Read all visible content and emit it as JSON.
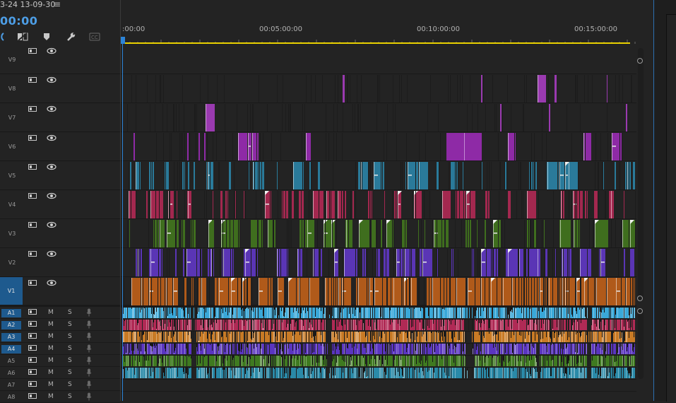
{
  "sequence": {
    "title": "3-24 13-09-30",
    "timecode": "00:00"
  },
  "icons": {
    "menu": "hamburger-menu-icon",
    "snap": "snap-icon",
    "linked": "linked-selection-icon",
    "marker": "marker-icon",
    "settings": "wrench-icon",
    "captions": "captions-icon",
    "toggle_output": "film-icon",
    "visibility": "eye-icon",
    "voiceover": "microphone-icon"
  },
  "ruler": {
    "labels": [
      ":00:00",
      "00:05:00:00",
      "00:10:00:00",
      "00:15:00:00"
    ]
  },
  "video_tracks": [
    {
      "id": "V9"
    },
    {
      "id": "V8"
    },
    {
      "id": "V7"
    },
    {
      "id": "V6"
    },
    {
      "id": "V5"
    },
    {
      "id": "V4"
    },
    {
      "id": "V3"
    },
    {
      "id": "V2"
    },
    {
      "id": "V1",
      "selected": true
    }
  ],
  "audio_tracks": [
    {
      "id": "A1",
      "selected": true
    },
    {
      "id": "A2",
      "selected": true
    },
    {
      "id": "A3",
      "selected": true
    },
    {
      "id": "A4",
      "selected": true
    },
    {
      "id": "A5"
    },
    {
      "id": "A6"
    },
    {
      "id": "A7"
    },
    {
      "id": "A8"
    }
  ],
  "audio_buttons": {
    "mute": "M",
    "solo": "S"
  },
  "colors": {
    "V8": "#9a3ab0",
    "V7": "#9a3ab0",
    "V6": "#8e2aa6",
    "V5": "#2a7a9a",
    "V4": "#a3284f",
    "V3": "#3f6e1e",
    "V2": "#5a35b5",
    "V1": "#b05a1a",
    "A1": "#3aa8d8",
    "A2": "#b02a55",
    "A3": "#c87a25",
    "A4": "#5a35c0",
    "A5": "#3f7a20",
    "A6": "#2a8aa8",
    "accent": "#2c84d8",
    "workarea": "#e8d000"
  }
}
